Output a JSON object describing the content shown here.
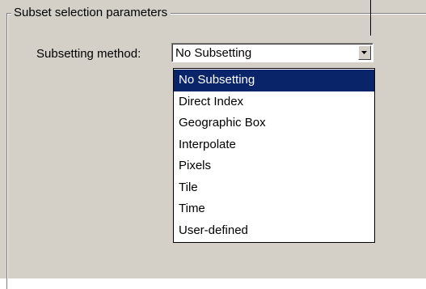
{
  "group": {
    "title": "Subset selection parameters"
  },
  "subsetting": {
    "label": "Subsetting method:",
    "selected_value": "No Subsetting",
    "options": [
      "No Subsetting",
      "Direct Index",
      "Geographic Box",
      "Interpolate",
      "Pixels",
      "Tile",
      "Time",
      "User-defined"
    ]
  },
  "icons": {
    "dropdown_arrow": "chevron-down-icon"
  },
  "colors": {
    "panel_background": "#d4d0c8",
    "selection_highlight": "#0a246a",
    "list_background": "#ffffff"
  }
}
